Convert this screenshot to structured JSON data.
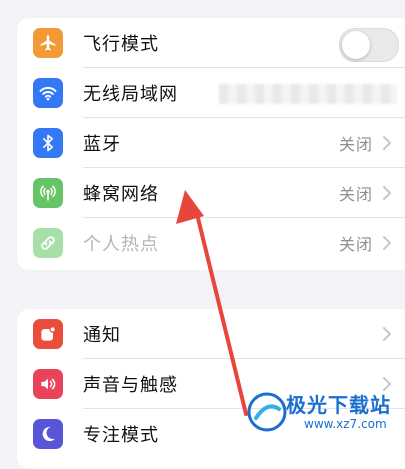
{
  "group1": {
    "items": [
      {
        "label": "飞行模式",
        "icon": "airplane-icon",
        "color": "#f19a37",
        "toggle": "off"
      },
      {
        "label": "无线局域网",
        "icon": "wifi-icon",
        "color": "#3478f6"
      },
      {
        "label": "蓝牙",
        "icon": "bluetooth-icon",
        "color": "#3478f6",
        "value": "关闭"
      },
      {
        "label": "蜂窝网络",
        "icon": "cellular-icon",
        "color": "#65c466",
        "value": "关闭"
      },
      {
        "label": "个人热点",
        "icon": "hotspot-icon",
        "color": "#a7dfa8",
        "value": "关闭"
      }
    ]
  },
  "group2": {
    "items": [
      {
        "label": "通知",
        "icon": "notification-icon",
        "color": "#eb4d3d"
      },
      {
        "label": "声音与触感",
        "icon": "sound-icon",
        "color": "#eb445a"
      },
      {
        "label": "专注模式",
        "icon": "moon-icon",
        "color": "#5856d6"
      }
    ]
  },
  "watermark": {
    "title": "极光下载站",
    "url": "www.xz7.com"
  },
  "colors": {
    "annotation_arrow": "#e8453c",
    "chevron": "#c7c7cc"
  }
}
